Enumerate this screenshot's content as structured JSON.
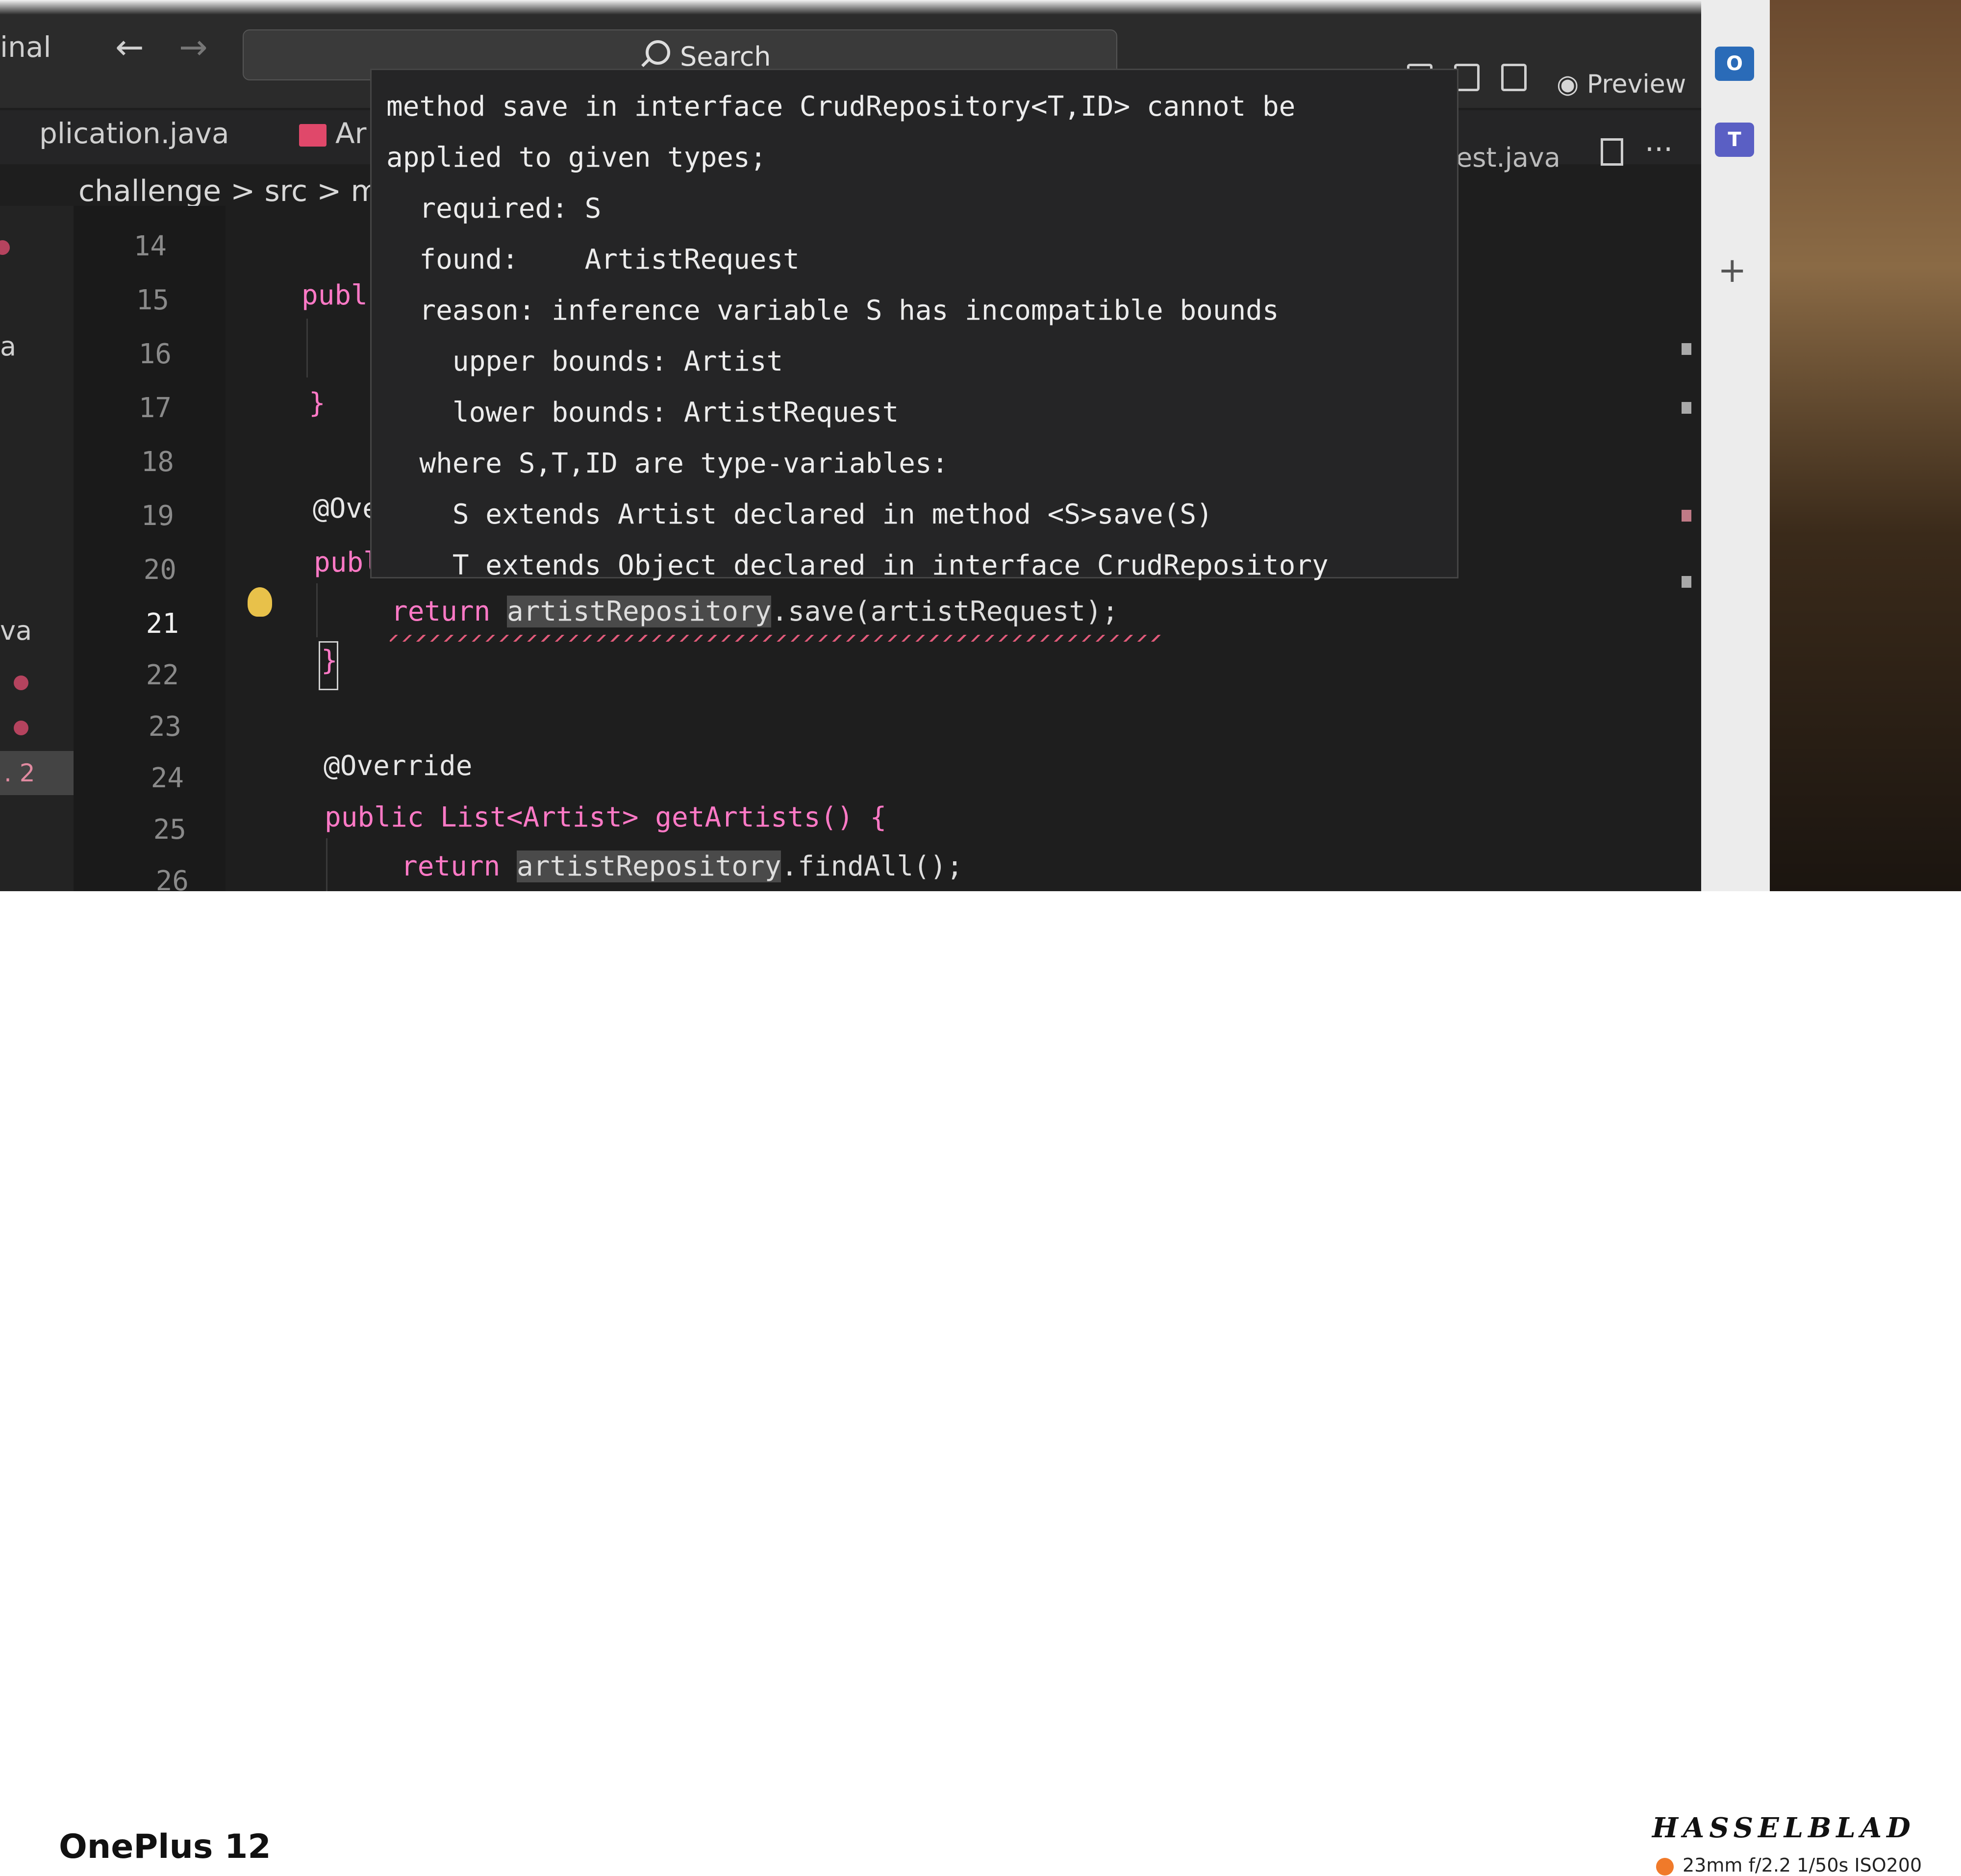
{
  "window": {
    "app_title": "inal",
    "search_label": "Search",
    "preview_label": "Preview"
  },
  "tabs": {
    "tab1": "plication.java",
    "tab2": "Ar",
    "tab3": "est.java"
  },
  "breadcrumb": "challenge > src > main",
  "sidebar_strip": {
    "text_a": "a",
    "text_va": "va",
    "badge": ". 2"
  },
  "line_numbers": [
    "14",
    "15",
    "16",
    "17",
    "18",
    "19",
    "20",
    "21",
    "22",
    "23",
    "24",
    "25",
    "26"
  ],
  "active_line": "21",
  "code": {
    "l15": "publ",
    "l17": "}",
    "l19": "@Ove",
    "l20": "publ",
    "l21_kw": "return",
    "l21_ref": "artistRepository",
    "l21_rest": ".save(artistRequest);",
    "l22": "}",
    "l24": "@Override",
    "l25": "public List<Artist> getArtists() {",
    "l26_kw": "return",
    "l26_ref": "artistRepository",
    "l26_rest": ".findAll();"
  },
  "tooltip": {
    "lines": [
      "method save in interface CrudRepository<T,ID> cannot be",
      "applied to given types;",
      "  required: S",
      "  found:    ArtistRequest",
      "  reason: inference variable S has incompatible bounds",
      "    upper bounds: Artist",
      "    lower bounds: ArtistRequest",
      "  where S,T,ID are type-variables:",
      "    S extends Artist declared in method <S>save(S)",
      "    T extends Object declared in interface CrudRepository"
    ]
  },
  "footer": {
    "device": "OnePlus 12",
    "brand": "HASSELBLAD",
    "exif": "23mm  f/2.2  1/50s  ISO200"
  },
  "colors": {
    "editor_bg": "#1e1e1e",
    "error_squiggle": "#e05a7a",
    "keyword": "#ff79c6",
    "exif_dot": "#f07a2a"
  }
}
